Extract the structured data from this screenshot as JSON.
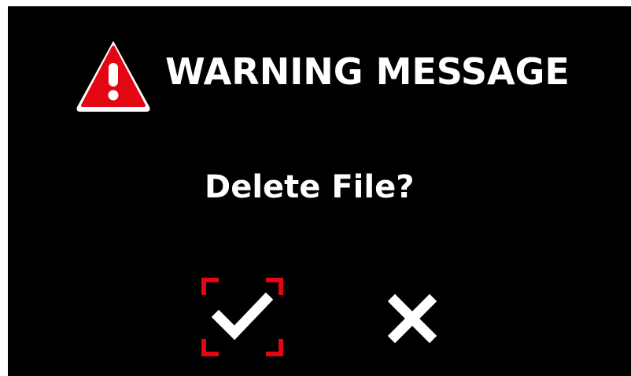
{
  "dialog": {
    "title": "WARNING MESSAGE",
    "question": "Delete File?",
    "icons": {
      "warning": "warning-triangle-icon",
      "confirm": "checkmark-icon",
      "cancel": "close-x-icon"
    },
    "colors": {
      "background": "#000000",
      "text": "#ffffff",
      "warning": "#e30613",
      "focus_brackets": "#e30613"
    }
  }
}
